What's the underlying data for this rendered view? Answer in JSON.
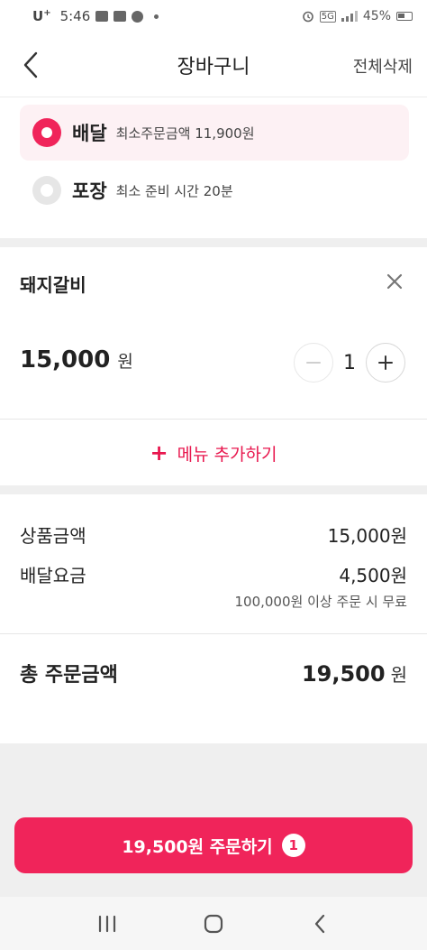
{
  "status_bar": {
    "carrier": "U",
    "carrier_sup": "+",
    "time": "5:46",
    "network": "5G",
    "battery": "45%"
  },
  "header": {
    "title": "장바구니",
    "clear_all": "전체삭제",
    "back_icon": "chevron-left-icon"
  },
  "order_type": {
    "options": [
      {
        "name": "배달",
        "desc": "최소주문금액 11,900원",
        "selected": true
      },
      {
        "name": "포장",
        "desc": "최소 준비 시간 20분",
        "selected": false
      }
    ]
  },
  "cart": {
    "items": [
      {
        "name": "돼지갈비",
        "price": "15,000",
        "unit": "원",
        "quantity": "1"
      }
    ],
    "add_menu_label": "메뉴 추가하기",
    "add_menu_icon": "plus-icon"
  },
  "summary": {
    "subtotal_label": "상품금액",
    "subtotal_value": "15,000원",
    "delivery_label": "배달요금",
    "delivery_value": "4,500원",
    "delivery_note": "100,000원 이상 주문 시 무료",
    "total_label": "총 주문금액",
    "total_value": "19,500",
    "total_unit": "원"
  },
  "order_button": {
    "label": "19,500원 주문하기",
    "badge": "1"
  },
  "colors": {
    "accent": "#f0245a",
    "accent_light": "#fdf1f4",
    "divider": "#efefef"
  }
}
